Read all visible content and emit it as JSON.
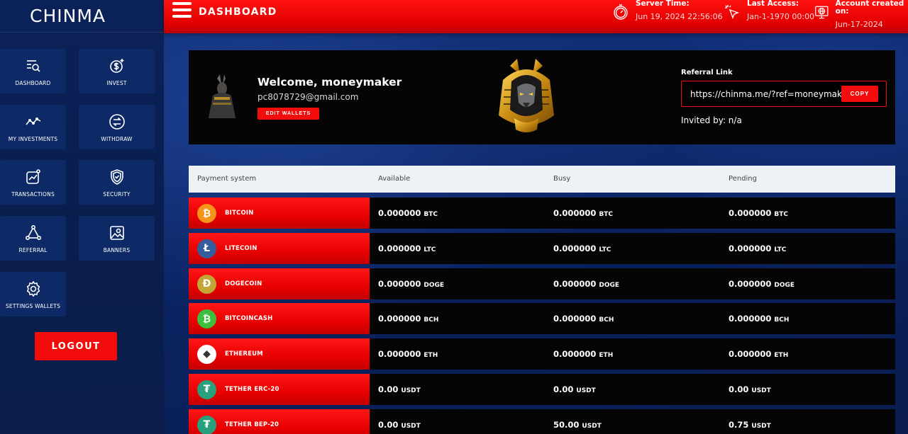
{
  "brand": "CHINMA",
  "header": {
    "title": "DASHBOARD",
    "server_time_label": "Server Time:",
    "server_time_value": "Jun 19, 2024 22:56:06",
    "last_access_label": "Last Access:",
    "last_access_value": "Jan-1-1970 00:00",
    "account_created_label": "Account created on:",
    "account_created_value": "Jun-17-2024"
  },
  "sidebar": {
    "items": [
      {
        "label": "DASHBOARD",
        "icon": "dashboard-search-icon"
      },
      {
        "label": "INVEST",
        "icon": "dollar-plus-icon"
      },
      {
        "label": "MY INVESTMENTS",
        "icon": "trend-line-icon"
      },
      {
        "label": "WITHDRAW",
        "icon": "exchange-arrows-icon"
      },
      {
        "label": "TRANSACTIONS",
        "icon": "chart-up-icon"
      },
      {
        "label": "SECURITY",
        "icon": "shield-check-icon"
      },
      {
        "label": "REFERRAL",
        "icon": "network-icon"
      },
      {
        "label": "BANNERS",
        "icon": "image-icon"
      },
      {
        "label": "SETTINGS WALLETS",
        "icon": "gear-icon"
      }
    ],
    "logout_label": "LOGOUT"
  },
  "welcome": {
    "greeting": "Welcome, moneymaker",
    "email": "pc8078729@gmail.com",
    "edit_wallets_label": "EDIT WALLETS",
    "referral_label": "Referral Link",
    "referral_link": "https://chinma.me/?ref=moneymaker",
    "copy_label": "COPY",
    "invited_by": "Invited by: n/a"
  },
  "table": {
    "headers": [
      "Payment system",
      "Available",
      "Busy",
      "Pending"
    ],
    "rows": [
      {
        "name": "BITCOIN",
        "coin_color": "#f7931a",
        "glyph": "₿",
        "available": "0.000000",
        "busy": "0.000000",
        "pending": "0.000000",
        "currency": "BTC"
      },
      {
        "name": "LITECOIN",
        "coin_color": "#345d9d",
        "glyph": "Ł",
        "available": "0.000000",
        "busy": "0.000000",
        "pending": "0.000000",
        "currency": "LTC"
      },
      {
        "name": "DOGECOIN",
        "coin_color": "#c2a633",
        "glyph": "Ð",
        "available": "0.000000",
        "busy": "0.000000",
        "pending": "0.000000",
        "currency": "DOGE"
      },
      {
        "name": "BITCOINCASH",
        "coin_color": "#3cc03c",
        "glyph": "₿",
        "available": "0.000000",
        "busy": "0.000000",
        "pending": "0.000000",
        "currency": "BCH"
      },
      {
        "name": "ETHEREUM",
        "coin_color": "#ffffff",
        "glyph": "◆",
        "available": "0.000000",
        "busy": "0.000000",
        "pending": "0.000000",
        "currency": "ETH"
      },
      {
        "name": "TETHER ERC-20",
        "coin_color": "#26a17b",
        "glyph": "₮",
        "available": "0.00",
        "busy": "0.00",
        "pending": "0.00",
        "currency": "USDT"
      },
      {
        "name": "TETHER BEP-20",
        "coin_color": "#26a17b",
        "glyph": "₮",
        "available": "0.00",
        "busy": "50.00",
        "pending": "0.75",
        "currency": "USDT"
      }
    ]
  }
}
